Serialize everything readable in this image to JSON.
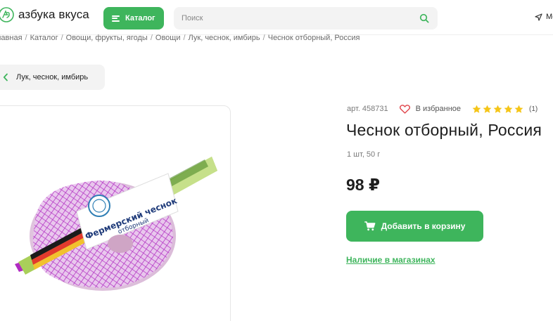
{
  "header": {
    "logo_text": "азбука вкуса",
    "catalog_label": "Каталог",
    "search_placeholder": "Поиск",
    "geo_label": "Мо"
  },
  "breadcrumb": [
    "лавная",
    "Каталог",
    "Овощи, фрукты, ягоды",
    "Овощи",
    "Лук, чеснок, имбирь",
    "Чеснок отборный, Россия"
  ],
  "back_link": {
    "label": "Лук, чеснок, имбирь"
  },
  "product": {
    "article": "арт. 458731",
    "favorite_label": "В избранное",
    "rating": {
      "stars": 5,
      "count": "(1)"
    },
    "title": "Чеснок отборный, Россия",
    "weight": "1 шт, 50 г",
    "price": "98 ₽",
    "add_to_cart_label": "Добавить в корзину",
    "stores_link": "Наличие в магазинах"
  },
  "image_label": {
    "line1": "Фермерский чеснок",
    "line2": "отборный"
  },
  "colors": {
    "accent": "#3eb55c",
    "star": "#f5c518",
    "heart": "#e0454b"
  }
}
